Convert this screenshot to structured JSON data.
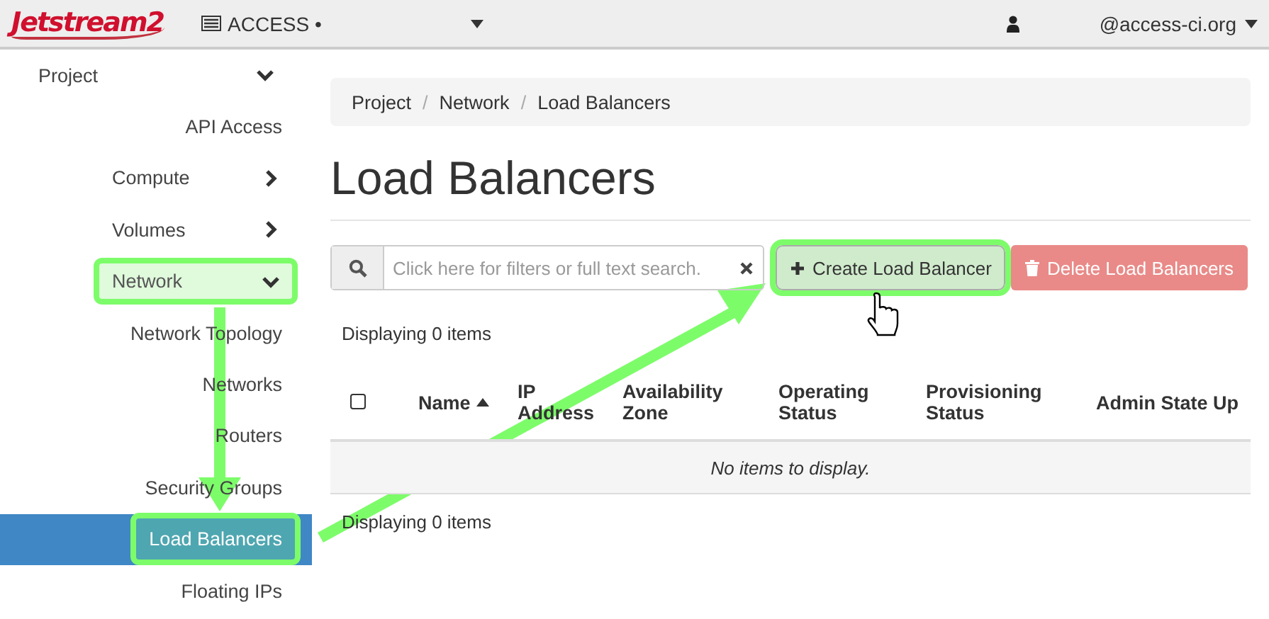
{
  "topbar": {
    "logo": "Jetstream2",
    "project": "ACCESS •",
    "user": "@access-ci.org"
  },
  "sidebar": {
    "items": [
      {
        "kind": "section",
        "label": "Project",
        "expanded": true,
        "selected": false,
        "highlighted": false,
        "children": [
          {
            "kind": "link",
            "label": "API Access",
            "selected": false,
            "highlighted": false
          },
          {
            "kind": "section",
            "label": "Compute",
            "expanded": false,
            "selected": false,
            "highlighted": false
          },
          {
            "kind": "section",
            "label": "Volumes",
            "expanded": false,
            "selected": false,
            "highlighted": false
          },
          {
            "kind": "section",
            "label": "Network",
            "expanded": true,
            "selected": false,
            "highlighted": true,
            "children": [
              {
                "kind": "link",
                "label": "Network Topology",
                "selected": false,
                "highlighted": false
              },
              {
                "kind": "link",
                "label": "Networks",
                "selected": false,
                "highlighted": false
              },
              {
                "kind": "link",
                "label": "Routers",
                "selected": false,
                "highlighted": false
              },
              {
                "kind": "link",
                "label": "Security Groups",
                "selected": false,
                "highlighted": false
              },
              {
                "kind": "link",
                "label": "Load Balancers",
                "selected": true,
                "highlighted": true
              },
              {
                "kind": "link",
                "label": "Floating IPs",
                "selected": false,
                "highlighted": false
              }
            ]
          }
        ]
      }
    ]
  },
  "breadcrumb": {
    "separator": "/",
    "items": [
      "Project",
      "Network",
      "Load Balancers"
    ]
  },
  "page_title": "Load Balancers",
  "search": {
    "placeholder": "Click here for filters or full text search."
  },
  "buttons": [
    {
      "kind": "create",
      "label": "Create Load Balancer",
      "highlighted": true
    },
    {
      "kind": "delete",
      "label": "Delete Load Balancers",
      "highlighted": false
    }
  ],
  "count_top": "Displaying 0 items",
  "table": {
    "columns": [
      {
        "label": "Name",
        "sorted": true
      },
      {
        "label": "IP Address",
        "sorted": false
      },
      {
        "label": "Availability Zone",
        "sorted": false
      },
      {
        "label": "Operating Status",
        "sorted": false
      },
      {
        "label": "Provisioning Status",
        "sorted": false
      },
      {
        "label": "Admin State Up",
        "sorted": false
      }
    ],
    "select_all": {
      "checked": false
    },
    "empty": "No items to display."
  },
  "count_bottom": "Displaying 0 items"
}
